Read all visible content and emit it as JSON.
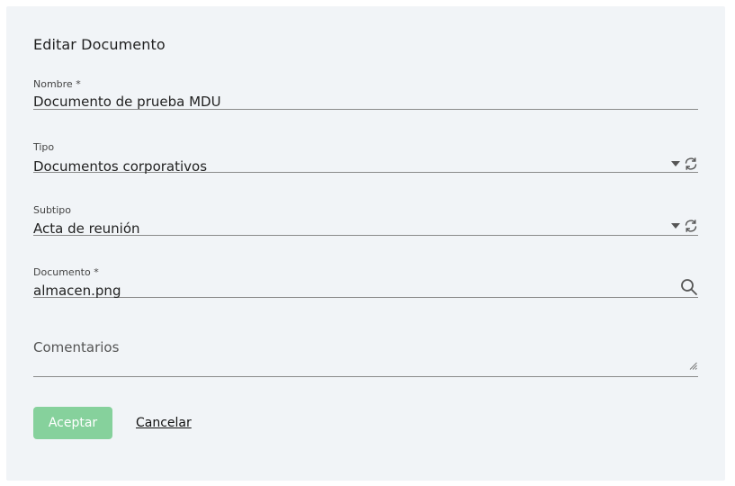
{
  "dialog": {
    "title": "Editar Documento"
  },
  "fields": {
    "nombre": {
      "label": "Nombre *",
      "value": "Documento de prueba MDU"
    },
    "tipo": {
      "label": "Tipo",
      "value": "Documentos corporativos"
    },
    "subtipo": {
      "label": "Subtipo",
      "value": "Acta de reunión"
    },
    "documento": {
      "label": "Documento *",
      "value": "almacen.png"
    },
    "comentarios": {
      "label": "Comentarios",
      "value": ""
    }
  },
  "actions": {
    "accept_label": "Aceptar",
    "cancel_label": "Cancelar"
  },
  "icons": {
    "dropdown": "caret-down-icon",
    "refresh": "refresh-icon",
    "search": "search-icon",
    "resize": "resize-handle-icon"
  },
  "colors": {
    "dialog_background": "#f1f4f7",
    "accept_button": "#86d19c",
    "underline": "#8a8a8a"
  }
}
